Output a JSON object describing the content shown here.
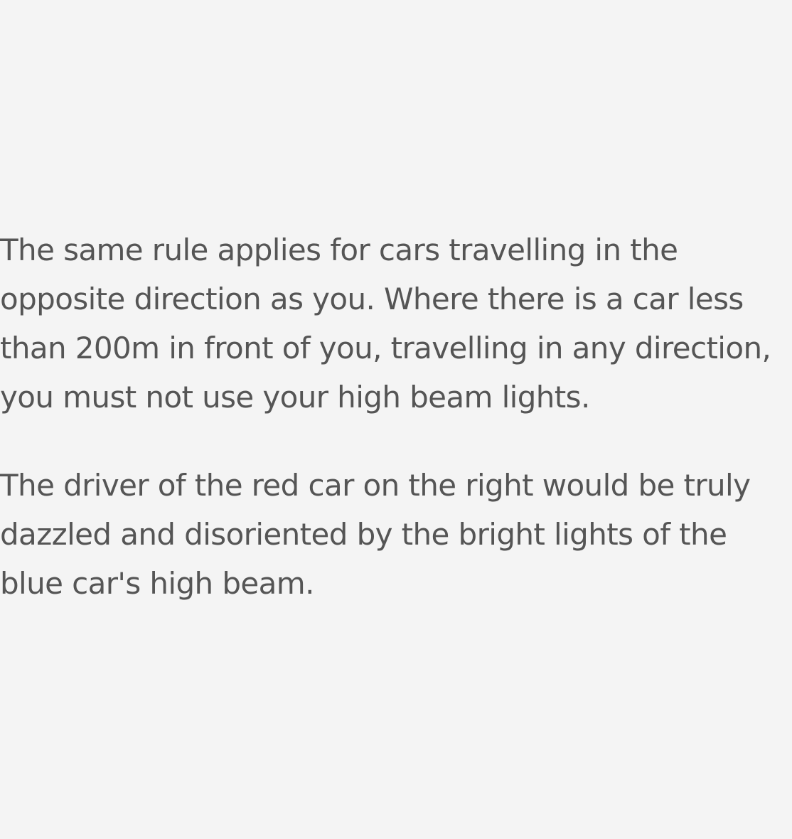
{
  "content": {
    "paragraphs": [
      "The same rule applies for cars travelling in the opposite direction as you. Where there is a car less than 200m in front of you, travelling in any direction, you must not use your high beam lights.",
      "The driver of the red car on the right would be truly dazzled and disoriented by the bright lights of the blue car's high beam."
    ]
  },
  "colors": {
    "background": "#f4f4f4",
    "text": "#555555"
  }
}
